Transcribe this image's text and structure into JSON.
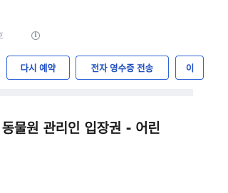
{
  "order_info": {
    "partial_label": "호",
    "info_icon": "info-icon"
  },
  "actions": {
    "rebook_label": "다시 예약",
    "receipt_label": "전자 영수증 전송",
    "more_label": "이"
  },
  "colors": {
    "accent": "#2e64d6",
    "divider": "#eef0f3",
    "title": "#1a1a1a"
  },
  "product": {
    "title": "동물원 관리인 입장권 - 어린"
  }
}
